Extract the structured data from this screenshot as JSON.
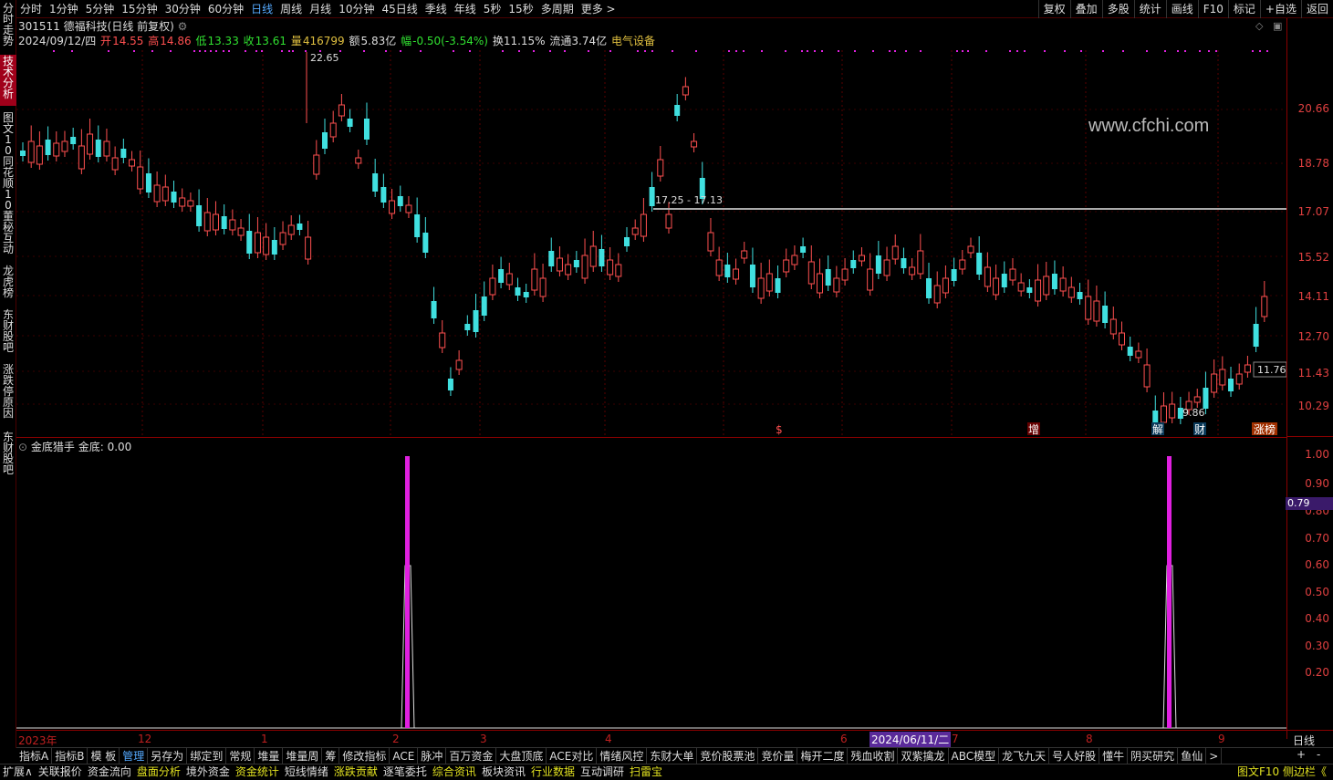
{
  "topbar": {
    "items": [
      "分时",
      "1分钟",
      "5分钟",
      "15分钟",
      "30分钟",
      "60分钟",
      "日线",
      "周线",
      "月线",
      "10分钟",
      "45日线",
      "季线",
      "年线",
      "5秒",
      "15秒",
      "多周期",
      "更多 >"
    ],
    "selected": "日线"
  },
  "right_top": [
    "复权",
    "叠加",
    "多股",
    "统计",
    "画线",
    "F10",
    "标记",
    "+自选",
    "返回"
  ],
  "sidebar": [
    "分时走势",
    "技术分析",
    "图文10",
    "同花顺10",
    "董秘互动",
    "龙虎榜",
    "东财股吧",
    "涨跌停原因",
    "东财股吧"
  ],
  "stock": {
    "code": "301511",
    "name": "德福科技(日线 前复权)",
    "date": "2024/09/12/四",
    "open_label": "开",
    "open": "14.55",
    "high_label": "高",
    "high": "14.86",
    "low_label": "低",
    "low": "13.33",
    "close_label": "收",
    "close": "13.61",
    "vol_label": "量",
    "volume": "416799",
    "amt_label": "额",
    "amount": "5.83亿",
    "chg_label": "幅",
    "change": "-0.50(-3.54%)",
    "turnover": "换11.15%",
    "float": "流通3.74亿",
    "sector": "电气设备"
  },
  "chart": {
    "watermark": "www.cfchi.com",
    "high_annot": "22.65",
    "low_annot": "9.86",
    "line_label": "17.25 - 17.13",
    "last_price": "11.76",
    "markers": [
      {
        "t": "$"
      },
      {
        "t": "增"
      },
      {
        "t": "解"
      },
      {
        "t": "财"
      },
      {
        "t": "涨榜"
      }
    ]
  },
  "price_axis": [
    "20.66",
    "18.78",
    "17.07",
    "15.52",
    "14.11",
    "12.70",
    "11.43",
    "10.29"
  ],
  "indicator": {
    "name": "金底猎手",
    "value_label": "金底: 0.00",
    "axis": [
      "1.00",
      "0.90",
      "0.80",
      "0.70",
      "0.60",
      "0.50",
      "0.40",
      "0.30",
      "0.20"
    ],
    "current": "0.79"
  },
  "dates": [
    "2023年",
    "12",
    "1",
    "2",
    "3",
    "4",
    "2024/06/11/二",
    "6",
    "7",
    "8",
    "9"
  ],
  "period_label": "日线",
  "zoom": [
    "+",
    "-"
  ],
  "tabs": [
    "指标A",
    "指标B",
    "模 板",
    "管理",
    "另存为",
    "绑定到",
    "常规",
    "堆量",
    "堆量周",
    "筹",
    "修改指标",
    "ACE",
    "脉冲",
    "百万资金",
    "大盘顶底",
    "ACE对比",
    "情绪风控",
    "东财大单",
    "竞价股票池",
    "竞价量",
    "梅开二度",
    "残血收割",
    "双紫擒龙",
    "ABC模型",
    "龙飞九天",
    "号人好股",
    "懂牛",
    "阴买研究",
    "鱼仙",
    ">"
  ],
  "tabs_selected": "管理",
  "bottom": [
    "扩展∧",
    "关联报价",
    "资金流向",
    "盘面分析",
    "境外资金",
    "资金统计",
    "短线情绪",
    "涨跌贡献",
    "逐笔委托",
    "综合资讯",
    "板块资讯",
    "行业数据",
    "互动调研",
    "扫雷宝"
  ],
  "bottom_right": "图文F10 侧边栏《"
}
